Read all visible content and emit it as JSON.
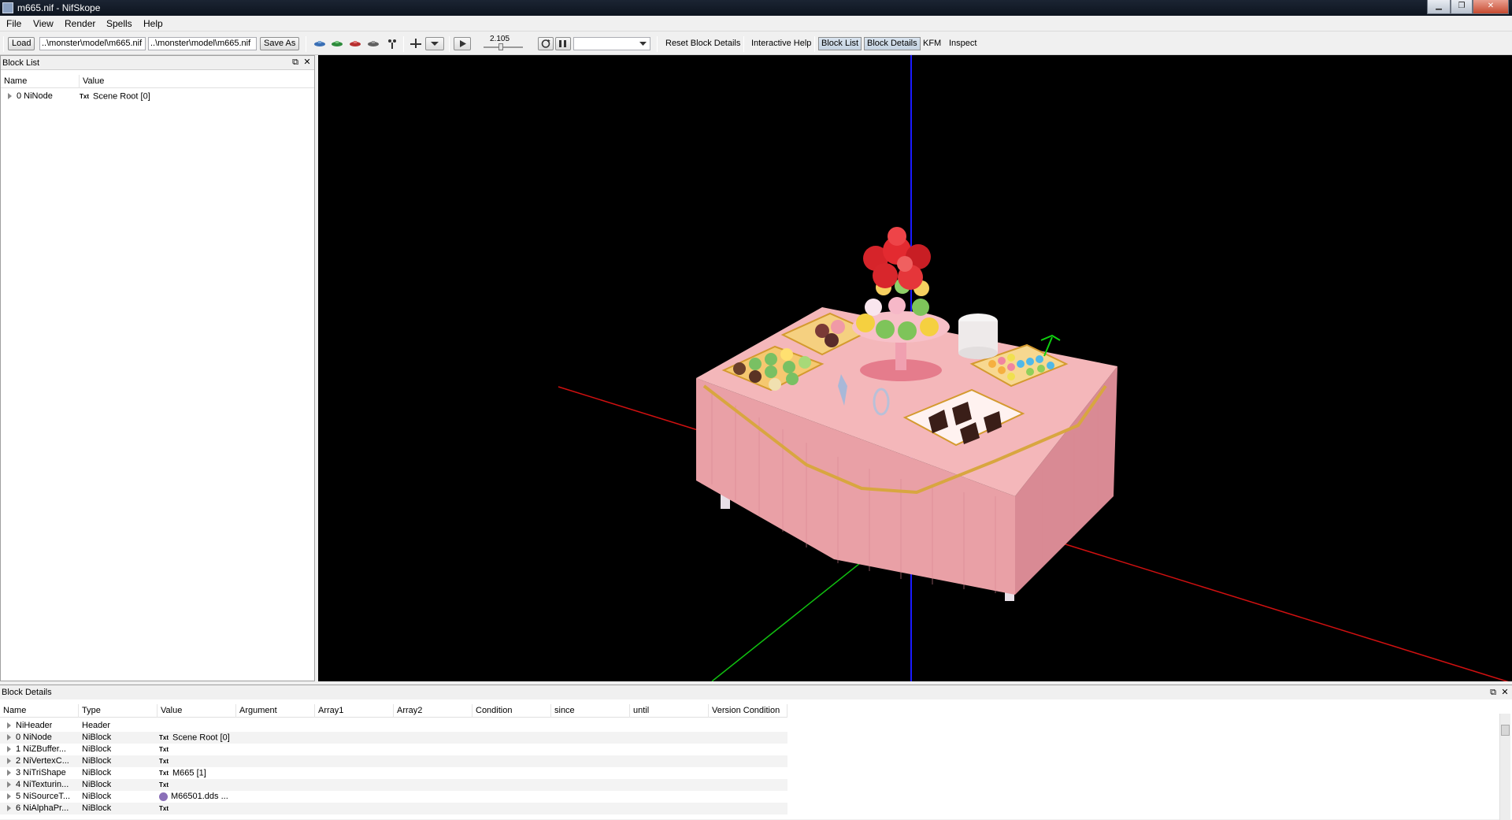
{
  "window": {
    "title": "m665.nif - NifSkope"
  },
  "menu": {
    "items": [
      "File",
      "View",
      "Render",
      "Spells",
      "Help"
    ]
  },
  "toolbar": {
    "load": "Load",
    "load_path": "..\\monster\\model\\m665.nif",
    "save_path": "..\\monster\\model\\m665.nif",
    "save_as": "Save As",
    "time_value": "2.105",
    "anim_select": "",
    "reset_block_details": "Reset Block Details",
    "interactive_help": "Interactive Help",
    "block_list": "Block List",
    "block_details": "Block Details",
    "kfm": "KFM",
    "inspect": "Inspect"
  },
  "block_list": {
    "title": "Block List",
    "columns": [
      "Name",
      "Value"
    ],
    "rows": [
      {
        "name": "0 NiNode",
        "value": "Scene Root [0]"
      }
    ]
  },
  "block_details": {
    "title": "Block Details",
    "columns": [
      "Name",
      "Type",
      "Value",
      "Argument",
      "Array1",
      "Array2",
      "Condition",
      "since",
      "until",
      "Version Condition"
    ],
    "rows": [
      {
        "name": "NiHeader",
        "type": "Header",
        "value": ""
      },
      {
        "name": "0 NiNode",
        "type": "NiBlock",
        "value": "Scene Root [0]"
      },
      {
        "name": "1 NiZBuffer...",
        "type": "NiBlock",
        "value": ""
      },
      {
        "name": "2 NiVertexC...",
        "type": "NiBlock",
        "value": ""
      },
      {
        "name": "3 NiTriShape",
        "type": "NiBlock",
        "value": "M665 [1]"
      },
      {
        "name": "4 NiTexturin...",
        "type": "NiBlock",
        "value": ""
      },
      {
        "name": "5 NiSourceT...",
        "type": "NiBlock",
        "value": "M66501.dds ..."
      },
      {
        "name": "6 NiAlphaPr...",
        "type": "NiBlock",
        "value": ""
      }
    ]
  },
  "icons": {
    "txt": "Txt"
  }
}
